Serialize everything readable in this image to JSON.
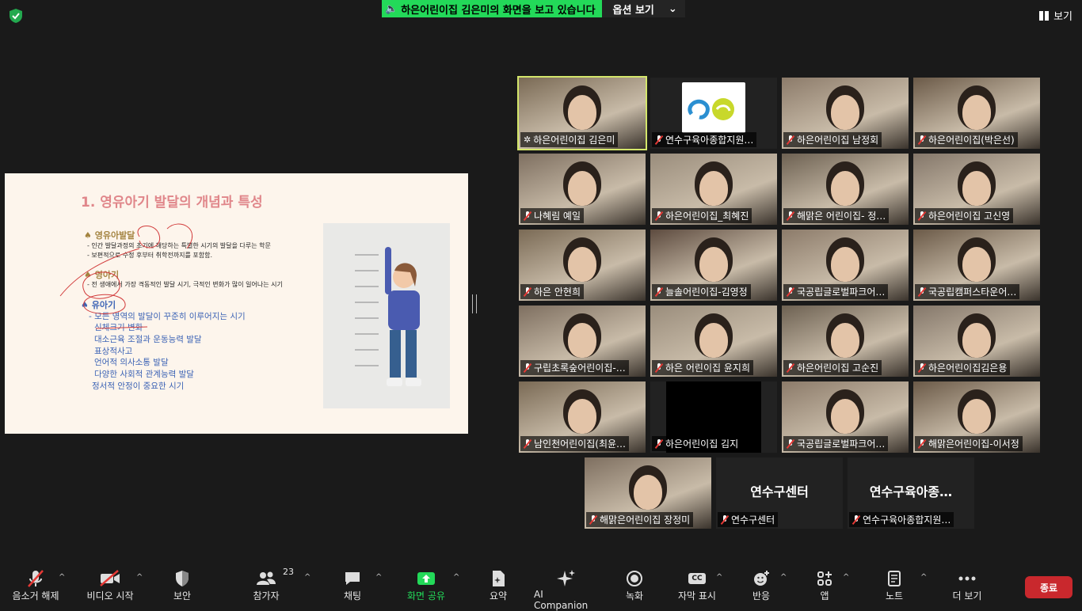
{
  "top_bar": {
    "share_banner": "하은어린이집 김은미의 화면을 보고 있습니다",
    "options": "옵션 보기",
    "view": "보기"
  },
  "slide": {
    "title": "1. 영유아기 발달의 개념과 특성",
    "sections": [
      {
        "heading": "영유아발달",
        "lines": [
          "- 인간 발달과정의 초기에 해당하는 특별한 시기의 발달을 다루는 학문",
          "- 보편적으로 수정 후부터 취학전까지를 포함함."
        ]
      },
      {
        "heading": "영아기",
        "lines": [
          "- 전 생애에서 가장 격동적인 발달 시기, 극적인 변화가 많이 일어나는 시기"
        ]
      },
      {
        "heading": "유아기",
        "lines": [
          "- 모든 영역의 발달이 꾸준히 이루어지는 시기",
          "신체크기 변화",
          "대소근육 조절과 운동능력 발달",
          "표상적사고",
          "언어적 의사소통 발달",
          "다양한 사회적 관계능력 발달",
          "정서적 안정이 중요한 시기"
        ]
      }
    ]
  },
  "participants": [
    {
      "name": "하은어린이집 김은미",
      "active": true,
      "muted": false,
      "feed": "camera"
    },
    {
      "name": "연수구육아종합지원…",
      "active": false,
      "muted": true,
      "feed": "logo"
    },
    {
      "name": "하은어린이집 남정회",
      "active": false,
      "muted": true,
      "feed": "camera"
    },
    {
      "name": "하은어린이집(박은선)",
      "active": false,
      "muted": true,
      "feed": "camera"
    },
    {
      "name": "나혜림 예일",
      "active": false,
      "muted": true,
      "feed": "camera"
    },
    {
      "name": "하은어린이집_최혜진",
      "active": false,
      "muted": true,
      "feed": "camera"
    },
    {
      "name": "해맑은 어린이집- 정…",
      "active": false,
      "muted": true,
      "feed": "camera"
    },
    {
      "name": "하은어린이집 고신영",
      "active": false,
      "muted": true,
      "feed": "camera"
    },
    {
      "name": "하은 안현희",
      "active": false,
      "muted": true,
      "feed": "camera"
    },
    {
      "name": "늘솔어린이집-김영정",
      "active": false,
      "muted": true,
      "feed": "camera"
    },
    {
      "name": "국공립글로벌파크어…",
      "active": false,
      "muted": true,
      "feed": "camera"
    },
    {
      "name": "국공립캠퍼스타운어…",
      "active": false,
      "muted": true,
      "feed": "camera"
    },
    {
      "name": "구립초록숲어린이집-…",
      "active": false,
      "muted": true,
      "feed": "camera"
    },
    {
      "name": "하은 어린이집 윤지희",
      "active": false,
      "muted": true,
      "feed": "camera"
    },
    {
      "name": "하은어린이집 고순진",
      "active": false,
      "muted": true,
      "feed": "camera"
    },
    {
      "name": "하은어린이집김은용",
      "active": false,
      "muted": true,
      "feed": "camera"
    },
    {
      "name": "남인천어린이집(최윤…",
      "active": false,
      "muted": true,
      "feed": "camera"
    },
    {
      "name": "하은어린이집 김지",
      "active": false,
      "muted": true,
      "feed": "black"
    },
    {
      "name": "국공립글로벌파크어…",
      "active": false,
      "muted": true,
      "feed": "camera"
    },
    {
      "name": "해맑은어린이집-이서정",
      "active": false,
      "muted": true,
      "feed": "camera"
    },
    {
      "name": "해맑은어린이집 장정미",
      "active": false,
      "muted": true,
      "feed": "camera"
    },
    {
      "name": "연수구센터",
      "active": false,
      "muted": true,
      "feed": "name",
      "big": "연수구센터"
    },
    {
      "name": "연수구육아종합지원…",
      "active": false,
      "muted": true,
      "feed": "name",
      "big": "연수구육아종…"
    }
  ],
  "toolbar": {
    "unmute": "음소거 해제",
    "start_video": "비디오 시작",
    "security": "보안",
    "participants": "참가자",
    "participant_count": "23",
    "chat": "채팅",
    "share_screen": "화면 공유",
    "summary": "요약",
    "ai_companion": "AI Companion",
    "record": "녹화",
    "captions": "자막 표시",
    "reactions": "반응",
    "apps": "앱",
    "notes": "노트",
    "more": "더 보기",
    "end": "종료",
    "captions_icon_text": "CC"
  },
  "colors": {
    "share_green": "#23d959",
    "active_border": "#d4e66b",
    "end_red": "#c9282d",
    "muted_red": "#e53935"
  }
}
